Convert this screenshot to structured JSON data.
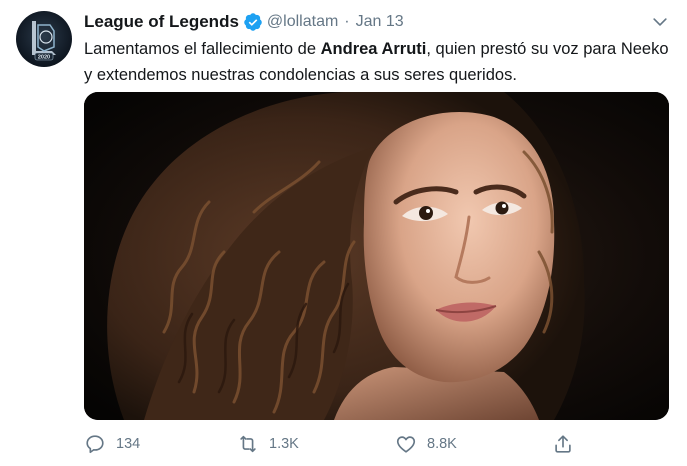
{
  "account": {
    "display_name": "League of Legends",
    "handle": "@lollatam",
    "separator": "·",
    "date": "Jan 13",
    "avatar_badge": "2020"
  },
  "tweet": {
    "text_before": "Lamentamos el fallecimiento de ",
    "text_bold": "Andrea Arruti",
    "text_after": ", quien prestó su voz para Neeko y extendemos nuestras condolencias a sus seres queridos."
  },
  "actions": {
    "replies": "134",
    "retweets": "1.3K",
    "likes": "8.8K"
  },
  "icons": {
    "verified": "verified-badge-icon",
    "caret": "chevron-down-icon",
    "reply": "reply-icon",
    "retweet": "retweet-icon",
    "like": "heart-icon",
    "share": "share-icon"
  },
  "colors": {
    "text": "#14171a",
    "secondary": "#657786",
    "verified": "#1da1f2"
  }
}
